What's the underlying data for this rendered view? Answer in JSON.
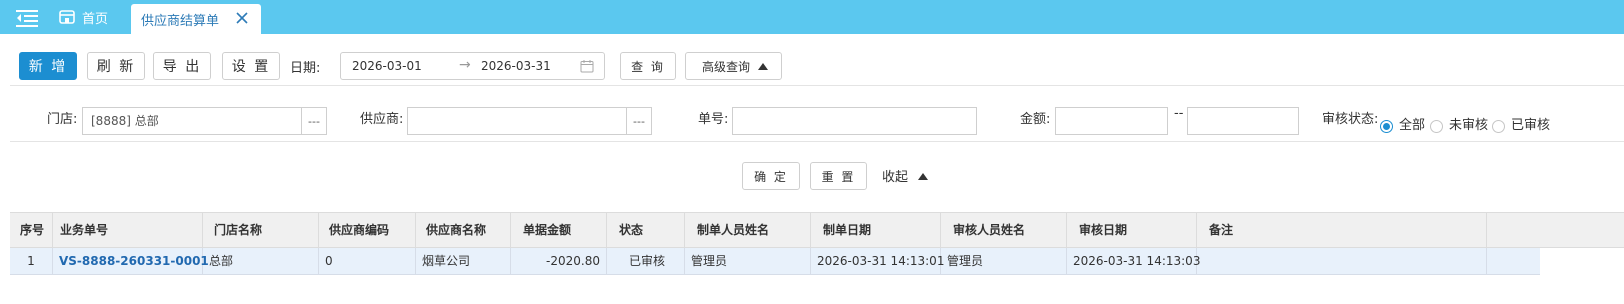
{
  "tabs": {
    "home_label": "首页",
    "active_label": "供应商结算单"
  },
  "toolbar": {
    "add_label": "新 增",
    "refresh_label": "刷 新",
    "export_label": "导 出",
    "settings_label": "设 置",
    "date_label": "日期:",
    "date_start": "2026-03-01",
    "date_end": "2026-03-31",
    "date_sep": "→",
    "query_label": "查 询",
    "advanced_label": "高级查询"
  },
  "filters": {
    "store_label": "门店:",
    "store_value": "[8888] 总部",
    "supplier_label": "供应商:",
    "supplier_value": "",
    "picker_label": "---",
    "order_label": "单号:",
    "order_value": "",
    "amount_label": "金额:",
    "amount_min": "",
    "amount_max": "",
    "amount_sep": "--",
    "audit_label": "审核状态:",
    "audit_options": [
      "全部",
      "未审核",
      "已审核"
    ],
    "audit_selected": "全部"
  },
  "actions": {
    "confirm_label": "确 定",
    "reset_label": "重 置",
    "collapse_label": "收起"
  },
  "table": {
    "columns": [
      "序号",
      "业务单号",
      "门店名称",
      "供应商编码",
      "供应商名称",
      "单据金额",
      "状态",
      "制单人员姓名",
      "制单日期",
      "审核人员姓名",
      "审核日期",
      "备注"
    ],
    "rows": [
      [
        "1",
        "VS-8888-260331-0001",
        "总部",
        "0",
        "烟草公司",
        "-2020.80",
        "已审核",
        "管理员",
        "2026-03-31 14:13:01",
        "管理员",
        "2026-03-31 14:13:03",
        ""
      ]
    ]
  },
  "colors": {
    "tabbar": "#5bc8ef",
    "primary": "#1c8ed1",
    "link": "#2169b0",
    "row_highlight": "#e8f1fb"
  }
}
